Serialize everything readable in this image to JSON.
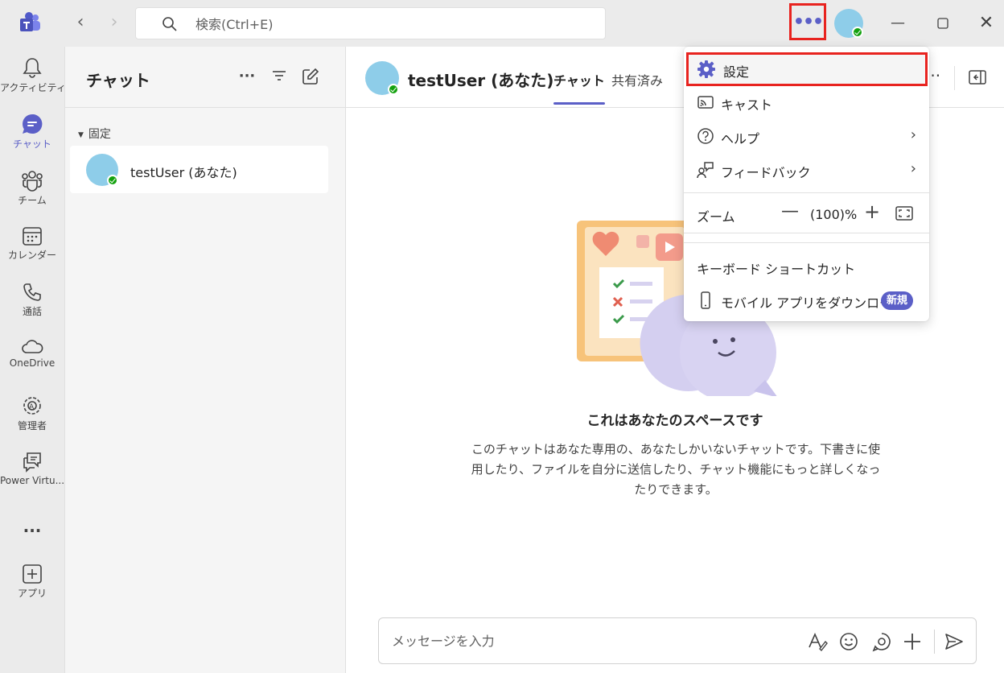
{
  "search": {
    "placeholder": "検索(Ctrl+E)"
  },
  "rail": {
    "items": [
      {
        "label": "アクティビティ"
      },
      {
        "label": "チャット"
      },
      {
        "label": "チーム"
      },
      {
        "label": "カレンダー"
      },
      {
        "label": "通話"
      },
      {
        "label": "OneDrive"
      },
      {
        "label": "管理者"
      },
      {
        "label": "Power Virtu..."
      },
      {
        "label": "..."
      },
      {
        "label": "アプリ"
      }
    ]
  },
  "chatlist": {
    "title": "チャット",
    "section": "固定",
    "chats": [
      {
        "name": "testUser (あなた)"
      }
    ]
  },
  "main": {
    "title": "testUser (あなた)",
    "tabs": [
      {
        "label": "チャット"
      },
      {
        "label": "共有済み"
      }
    ],
    "empty_title": "これはあなたのスペースです",
    "empty_desc": "このチャットはあなた専用の、あなたしかいないチャットです。下書きに使用したり、ファイルを自分に送信したり、チャット機能にもっと詳しくなったりできます。",
    "composer_placeholder": "メッセージを入力"
  },
  "menu": {
    "items": [
      {
        "label": "設定",
        "icon": "gear-icon"
      },
      {
        "label": "キャスト",
        "icon": "cast-icon"
      },
      {
        "label": "ヘルプ",
        "icon": "help-icon"
      },
      {
        "label": "フィードバック",
        "icon": "feedback-icon"
      }
    ],
    "zoom": {
      "label": "ズーム",
      "value": "(100)%"
    },
    "keyboard": "キーボード ショートカット",
    "mobile": "モバイル アプリをダウンロード",
    "badge": "新規"
  },
  "colors": {
    "accent": "#5b5fc7",
    "highlight": "#e8231f",
    "presence": "#13a10e"
  }
}
